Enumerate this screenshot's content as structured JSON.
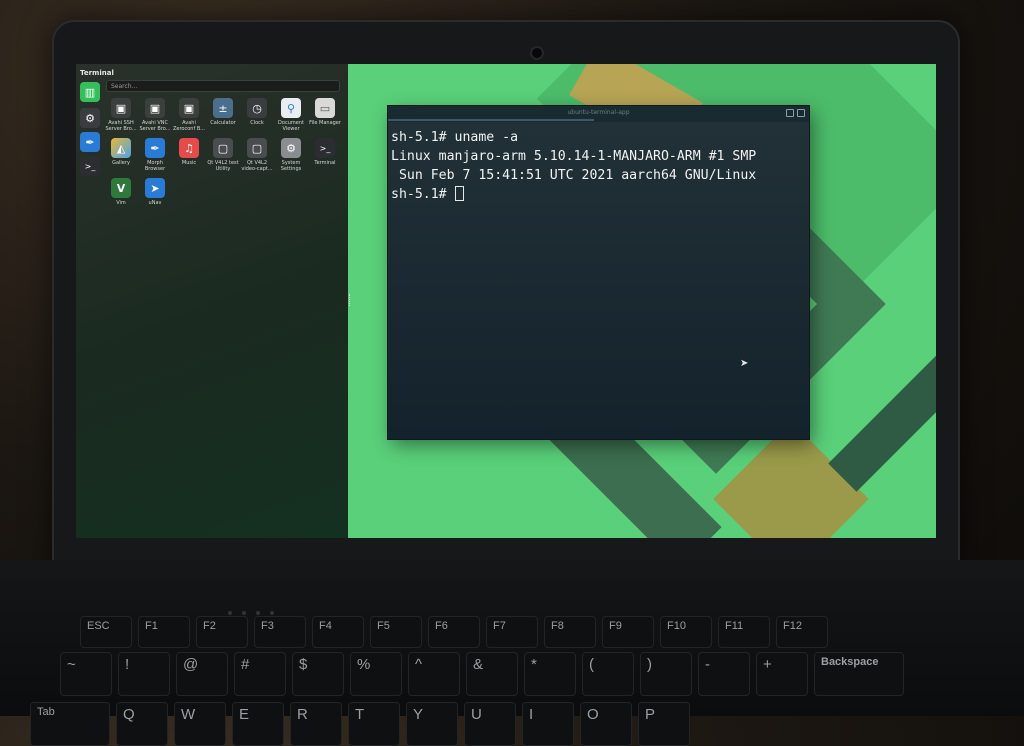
{
  "drawer": {
    "title": "Terminal",
    "search_placeholder": "Search...",
    "dock": [
      {
        "icon": "manjaro-logo-icon",
        "color": "#35bf5c"
      },
      {
        "icon": "gear-icon",
        "color": "#3a3d40"
      },
      {
        "icon": "feather-icon",
        "color": "#2a7bd5"
      },
      {
        "icon": "terminal-icon",
        "color": "#2b2d30"
      }
    ],
    "apps": [
      {
        "label": "Avahi SSH Server Bro...",
        "icon": "avahi-icon",
        "color": "#3b3f3e"
      },
      {
        "label": "Avahi VNC Server Bro...",
        "icon": "avahi-icon",
        "color": "#3b3f3e"
      },
      {
        "label": "Avahi Zeroconf B...",
        "icon": "avahi-icon",
        "color": "#3b3f3e"
      },
      {
        "label": "Calculator",
        "icon": "calculator-icon",
        "color": "#4a6f8c"
      },
      {
        "label": "Clock",
        "icon": "clock-icon",
        "color": "#3a3d40"
      },
      {
        "label": "Document Viewer",
        "icon": "document-viewer-icon",
        "color": "#e9eef3"
      },
      {
        "label": "File Manager",
        "icon": "folder-icon",
        "color": "#d9d9d9"
      },
      {
        "label": "Gallery",
        "icon": "gallery-icon",
        "color": "#e8b73a"
      },
      {
        "label": "Morph Browser",
        "icon": "morph-browser-icon",
        "color": "#2a7bd5"
      },
      {
        "label": "Music",
        "icon": "music-icon",
        "color": "#e64b4b"
      },
      {
        "label": "Qt V4L2 test Utility",
        "icon": "qt-icon",
        "color": "#4a4d50"
      },
      {
        "label": "Qt V4L2 video-capt...",
        "icon": "qt-icon",
        "color": "#4a4d50"
      },
      {
        "label": "System Settings",
        "icon": "gear-icon",
        "color": "#8a8d90"
      },
      {
        "label": "Terminal",
        "icon": "terminal-icon",
        "color": "#2b2d30"
      },
      {
        "label": "Vim",
        "icon": "vim-icon",
        "color": "#2f7a3a"
      },
      {
        "label": "uNav",
        "icon": "unav-icon",
        "color": "#2a7bd5"
      }
    ]
  },
  "terminal": {
    "window_title": "ubuntu-terminal-app",
    "lines": [
      "sh-5.1# uname -a",
      "Linux manjaro-arm 5.10.14-1-MANJARO-ARM #1 SMP",
      " Sun Feb 7 15:41:51 UTC 2021 aarch64 GNU/Linux",
      "sh-5.1# "
    ]
  },
  "keyboard": {
    "frow": [
      "ESC",
      "F1",
      "F2",
      "F3",
      "F4",
      "F5",
      "F6",
      "F7",
      "F8",
      "F9",
      "F10",
      "F11",
      "F12"
    ],
    "nrow": [
      "~",
      "!",
      "@",
      "#",
      "$",
      "%",
      "^",
      "&",
      "*",
      "(",
      ")",
      "-",
      "+",
      "Backspace"
    ],
    "qrow": [
      "Tab",
      "Q",
      "W",
      "E",
      "R",
      "T",
      "Y",
      "U",
      "I",
      "O",
      "P"
    ]
  },
  "colors": {
    "wallpaper_green": "#5ad07a",
    "terminal_bg": "#1a2a31"
  }
}
